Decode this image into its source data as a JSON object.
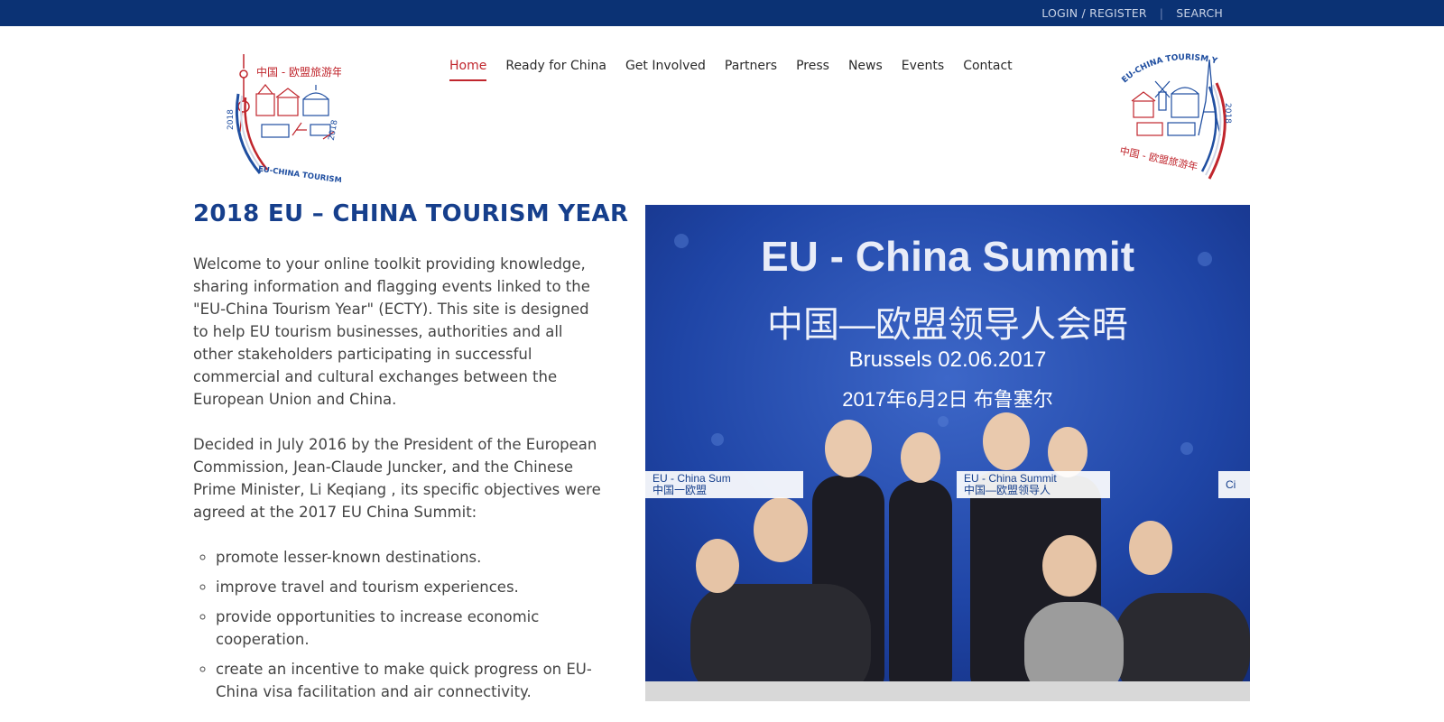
{
  "topbar": {
    "login_label": "LOGIN / REGISTER",
    "separator": "|",
    "search_label": "SEARCH"
  },
  "nav": {
    "items": [
      {
        "label": "Home",
        "active": true
      },
      {
        "label": "Ready for China"
      },
      {
        "label": "Get Involved"
      },
      {
        "label": "Partners"
      },
      {
        "label": "Press"
      },
      {
        "label": "News"
      },
      {
        "label": "Events"
      },
      {
        "label": "Contact"
      }
    ]
  },
  "logos": {
    "left_cn": "中国 - 欧盟旅游年",
    "left_en": "EU-CHINA TOURISM YEAR",
    "left_year": "2018",
    "right_en": "EU-CHINA TOURISM YEAR",
    "right_cn": "中国 - 欧盟旅游年",
    "right_year": "2018"
  },
  "main": {
    "title": "2018 EU – CHINA TOURISM YEAR",
    "paragraph1": "Welcome to your online toolkit providing knowledge, sharing information and flagging events linked to the \"EU-China Tourism Year\" (ECTY). This site is designed to help EU tourism businesses, authorities and all other stakeholders participating in successful commercial and cultural exchanges between the European Union and China.",
    "paragraph2": "Decided in July 2016 by the President of the European Commission, Jean-Claude Juncker, and the Chinese Prime Minister, Li Keqiang , its specific objectives were agreed at the 2017 EU China Summit:",
    "objectives": [
      "promote lesser-known destinations.",
      "improve travel and tourism experiences.",
      "provide opportunities to increase economic cooperation.",
      "create an incentive to make quick progress on EU-China visa facilitation and air connectivity."
    ]
  },
  "hero": {
    "title": "EU - China Summit",
    "cn_title": "中国—欧盟领导人会晤",
    "date": "Brussels 02.06.2017",
    "cn_date": "2017年6月2日  布鲁塞尔",
    "banner_en": "EU - China Summit",
    "banner_cn": "中国—欧盟领导人",
    "banner_en_short": "EU - China Sum",
    "banner_cn_short": "中国一欧盟",
    "banner_ci": "Ci"
  },
  "colors": {
    "topbar": "#0b3274",
    "title": "#163f8c",
    "nav_active": "#c0262d"
  }
}
